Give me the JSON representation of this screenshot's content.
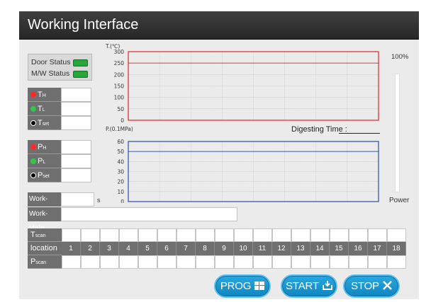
{
  "window": {
    "title": "Working Interface"
  },
  "status": {
    "door_label": "Door Status",
    "mw_label": "M/W Status",
    "led_color": "#27a63a"
  },
  "temperature": {
    "th": {
      "label": "T",
      "sub": "H"
    },
    "tl": {
      "label": "T",
      "sub": "L"
    },
    "tset": {
      "label": "T",
      "sub": "set"
    }
  },
  "pressure": {
    "ph": {
      "label": "P",
      "sub": "H"
    },
    "pl": {
      "label": "P",
      "sub": "L"
    },
    "pset": {
      "label": "P",
      "sub": "set"
    }
  },
  "work": {
    "time_label": "Work-time",
    "time_unit": "s",
    "state_label": "Work-state"
  },
  "temp_chart": {
    "unit": "T.(℃)",
    "ticks": [
      "300",
      "250",
      "200",
      "150",
      "100",
      "50",
      "0"
    ],
    "ylim": [
      0,
      300
    ],
    "line_value": 250,
    "border_color": "#e0262b"
  },
  "press_chart": {
    "unit": "P.(0.1MPa)",
    "ticks": [
      "60",
      "50",
      "40",
      "30",
      "20",
      "10",
      "0"
    ],
    "ylim": [
      0,
      60
    ],
    "line_value": 50,
    "border_color": "#2f49a8"
  },
  "digest": {
    "label": "Digesting Time :"
  },
  "power": {
    "max_label": "100%",
    "label": "Power"
  },
  "scan_table": {
    "tscan": {
      "label": "T",
      "sub": "scan"
    },
    "location_label": "location",
    "pscan": {
      "label": "P",
      "sub": "scan"
    },
    "locations": [
      "1",
      "2",
      "3",
      "4",
      "5",
      "6",
      "7",
      "8",
      "9",
      "10",
      "11",
      "12",
      "13",
      "14",
      "15",
      "16",
      "17",
      "18"
    ]
  },
  "buttons": {
    "prog": "PROG",
    "start": "START",
    "stop": "STOP"
  }
}
